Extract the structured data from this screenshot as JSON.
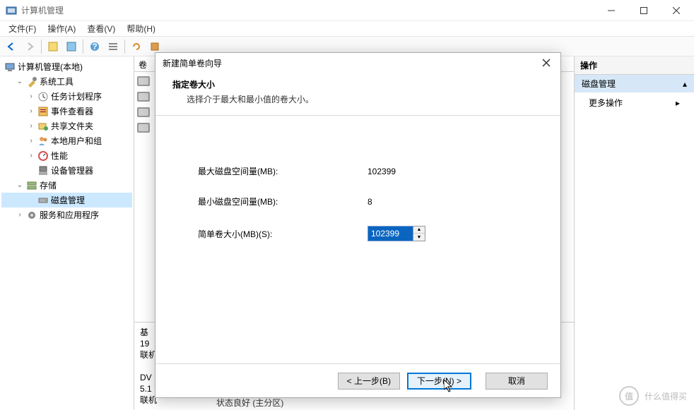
{
  "window": {
    "title": "计算机管理"
  },
  "menu": {
    "file": "文件(F)",
    "action": "操作(A)",
    "view": "查看(V)",
    "help": "帮助(H)"
  },
  "tree": {
    "root": "计算机管理(本地)",
    "system_tools": "系统工具",
    "task_scheduler": "任务计划程序",
    "event_viewer": "事件查看器",
    "shared_folders": "共享文件夹",
    "local_users": "本地用户和组",
    "performance": "性能",
    "device_manager": "设备管理器",
    "storage": "存储",
    "disk_management": "磁盘管理",
    "services": "服务和应用程序"
  },
  "middle": {
    "col_volume": "卷",
    "basic": "基",
    "size_19": "19",
    "online": "联机",
    "dvd": "DV",
    "ver": "5.1",
    "online2": "联机",
    "status_fragment": "状态良好 (主分区)"
  },
  "right": {
    "header": "操作",
    "section": "磁盘管理",
    "more_actions": "更多操作"
  },
  "wizard": {
    "title": "新建简单卷向导",
    "heading": "指定卷大小",
    "subheading": "选择介于最大和最小值的卷大小。",
    "max_label": "最大磁盘空间量(MB):",
    "max_value": "102399",
    "min_label": "最小磁盘空间量(MB):",
    "min_value": "8",
    "size_label": "简单卷大小(MB)(S):",
    "size_value": "102399",
    "back": "< 上一步(B)",
    "next": "下一步(N) >",
    "cancel": "取消"
  },
  "watermark": "什么值得买"
}
